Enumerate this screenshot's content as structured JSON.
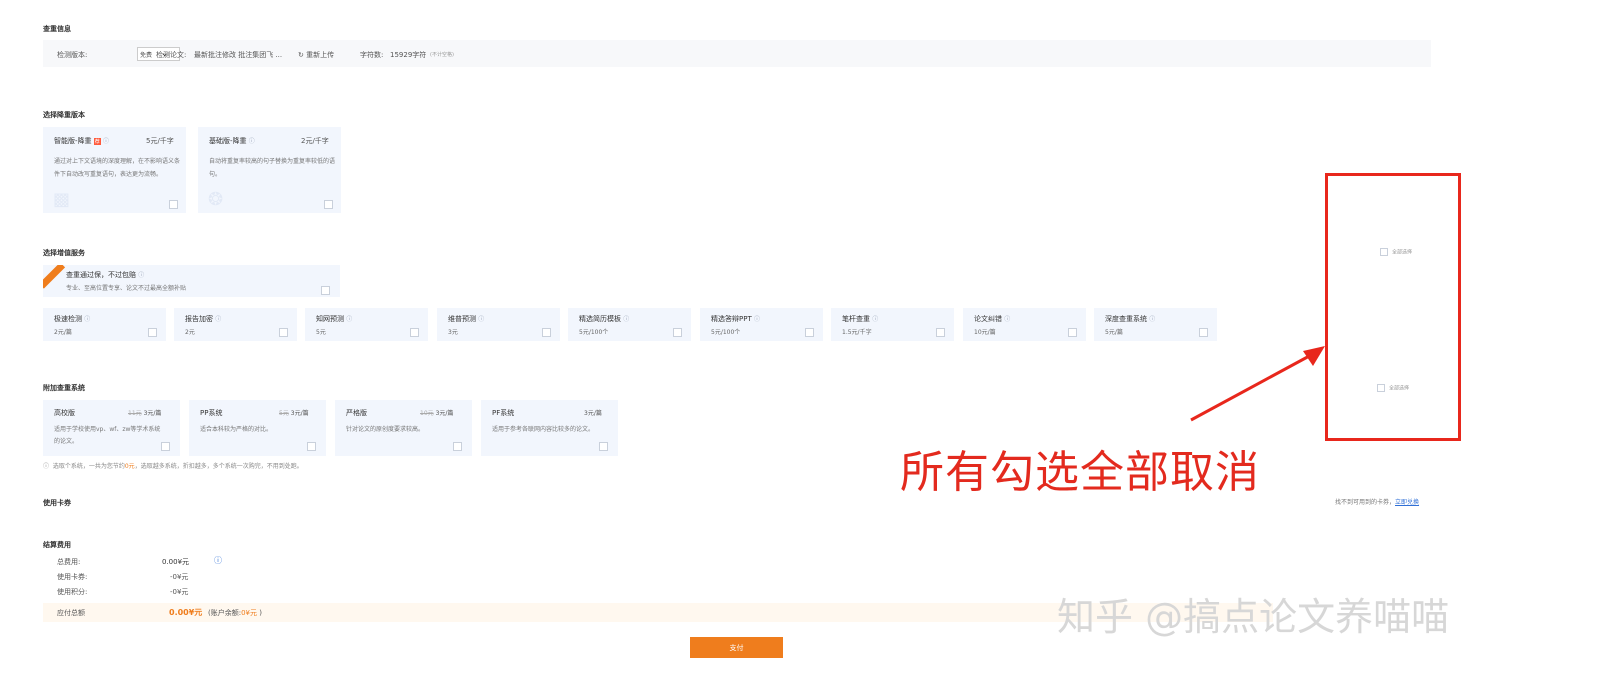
{
  "sections": {
    "info": "查重信息",
    "version": "选择降重版本",
    "services": "选择增值服务",
    "systems": "附加查重系统",
    "coupon": "使用卡券",
    "fees": "结算费用"
  },
  "info_bar": {
    "edition_label": "检测版本:",
    "edition_value": "免费",
    "paper_label": "检测论文:",
    "paper_value": "最新批注修改 批注集团飞 ...",
    "reupload": "重新上传",
    "chars_label": "字符数:",
    "chars_value": "15929字符",
    "chars_note": "(不计空格)"
  },
  "versions": [
    {
      "name": "智能版-降重",
      "badge": "荐",
      "price": "5元/千字",
      "desc": "通过对上下文语境的深度理解，在不影响语义条件下自动改写重复语句，表达更为流畅。",
      "checked": false
    },
    {
      "name": "基础版-降重",
      "price": "2元/千字",
      "desc": "自动将重复率较高的句子替换为重复率较低的语句。",
      "checked": false
    }
  ],
  "service_main": {
    "title": "查重通过保，不过包赔",
    "subtitle": "专业、至高位置专享、论文不过最高全额补贴",
    "checked": false
  },
  "services": [
    {
      "name": "极速检测",
      "price": "2元/篇",
      "checked": false
    },
    {
      "name": "报告加密",
      "price": "2元",
      "checked": false
    },
    {
      "name": "知网预测",
      "price": "5元",
      "checked": false
    },
    {
      "name": "维普预测",
      "price": "3元",
      "checked": false
    },
    {
      "name": "精选简历模板",
      "price": "5元/100个",
      "checked": false
    },
    {
      "name": "精选答辩PPT",
      "price": "5元/100个",
      "checked": false
    },
    {
      "name": "笔杆查重",
      "price": "1.5元/千字",
      "checked": false
    },
    {
      "name": "论文纠错",
      "price": "10元/篇",
      "checked": false
    },
    {
      "name": "深度查重系统",
      "price": "5元/篇",
      "checked": false
    }
  ],
  "systems": [
    {
      "name": "高校版",
      "old_price": "11元",
      "price": "3元/篇",
      "desc": "适用于学校使用vp、wf、zw等学术系统的论文。",
      "checked": false
    },
    {
      "name": "PP系统",
      "old_price": "5元",
      "price": "3元/篇",
      "desc": "适合本科较为严格的对比。",
      "checked": false
    },
    {
      "name": "严格版",
      "old_price": "10元",
      "price": "3元/篇",
      "desc": "针对论文的原创度要求较高。",
      "checked": false
    },
    {
      "name": "PF系统",
      "old_price": "",
      "price": "3元/篇",
      "desc": "适用于参考各联网内容比较多的论文。",
      "checked": false
    }
  ],
  "systems_note": {
    "text1": "选取个系统，一共为您节约",
    "amount": "0元",
    "text2": "，选取越多系统，折扣越多，多个系统一次购完，不用到处跑。"
  },
  "select_all": "全部选择",
  "coupon": {
    "hint": "找不到可用到的卡券，",
    "link": "立即兑换"
  },
  "fees": {
    "total_label": "总费用:",
    "total_value": "0.00¥元",
    "coupon_label": "使用卡券:",
    "coupon_value": "-0¥元",
    "points_label": "使用积分:",
    "points_value": "-0¥元",
    "due_label": "应付总额",
    "due_value": "0.00¥元",
    "balance_label": "(账户余额:",
    "balance_value": "0¥元",
    "balance_close": ")"
  },
  "pay_button": "支付",
  "annotation": "所有勾选全部取消",
  "watermark": "知乎 @搞点论文养喵喵",
  "colors": {
    "accent": "#ef7d1d",
    "annotation": "#e32a1e",
    "card_bg": "#f2f6fd",
    "link": "#2f6fd6"
  }
}
